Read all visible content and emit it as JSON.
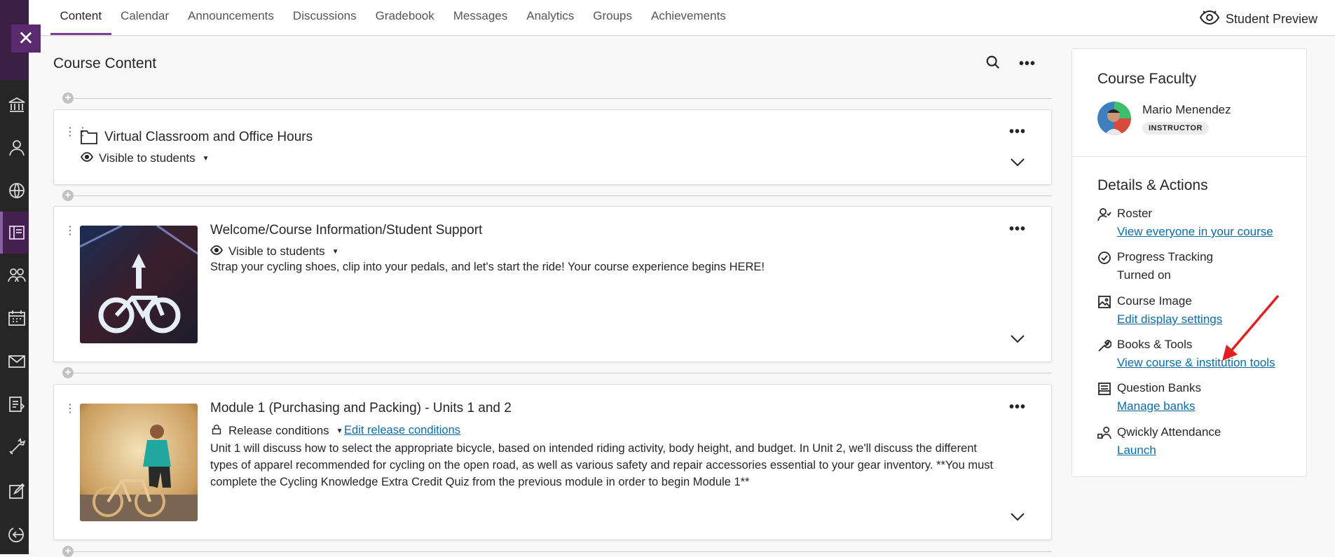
{
  "nav": {
    "tabs": [
      "Content",
      "Calendar",
      "Announcements",
      "Discussions",
      "Gradebook",
      "Messages",
      "Analytics",
      "Groups",
      "Achievements"
    ],
    "active_tab": "Content",
    "student_preview": "Student Preview"
  },
  "rail": {
    "close_glyph": "✕",
    "icons": [
      "institution-icon",
      "profile-icon",
      "globe-icon",
      "courses-icon",
      "groups-icon",
      "calendar-icon",
      "messages-icon",
      "grades-icon",
      "tools-icon",
      "notes-icon",
      "sign-out-icon"
    ]
  },
  "main": {
    "title": "Course Content",
    "items": [
      {
        "title": "Virtual Classroom and Office Hours",
        "visibility": "Visible to students",
        "icon": "folder-icon"
      },
      {
        "title": "Welcome/Course Information/Student Support",
        "visibility": "Visible to students",
        "description": "Strap your cycling shoes, clip into your pedals, and let's start the ride! Your course experience begins HERE!"
      },
      {
        "title": "Module 1 (Purchasing and Packing) - Units 1 and 2",
        "visibility": "Release conditions",
        "edit_link": "Edit release conditions",
        "description_lines": [
          "Unit 1 will discuss how to select the appropriate bicycle, based on intended riding activity, body height, and budget. In Unit 2, we'll discuss the different",
          "types of apparel recommended for cycling on the open road, as well as various safety and repair accessories essential to your gear inventory. **You must",
          "complete the Cycling Knowledge Extra Credit Quiz from the previous module in order to begin Module 1**"
        ]
      }
    ]
  },
  "panel": {
    "faculty_heading": "Course Faculty",
    "faculty_name": "Mario Menendez",
    "faculty_role": "INSTRUCTOR",
    "details_heading": "Details & Actions",
    "actions": [
      {
        "title": "Roster",
        "sub": "View everyone in your course",
        "link": true,
        "icon": "roster-icon"
      },
      {
        "title": "Progress Tracking",
        "sub": "Turned on",
        "link": false,
        "icon": "progress-check-icon"
      },
      {
        "title": "Course Image",
        "sub": "Edit display settings",
        "link": true,
        "icon": "image-icon"
      },
      {
        "title": "Books & Tools",
        "sub": "View course & institution tools",
        "link": true,
        "icon": "wrench-icon"
      },
      {
        "title": "Question Banks",
        "sub": "Manage banks",
        "link": true,
        "icon": "question-bank-icon"
      },
      {
        "title": "Qwickly Attendance",
        "sub": "Launch",
        "link": true,
        "icon": "attendance-icon"
      }
    ]
  },
  "colors": {
    "accent": "#7d4296",
    "link": "#0d6ca3",
    "rail": "#262626",
    "annotation_arrow": "#e02020"
  }
}
